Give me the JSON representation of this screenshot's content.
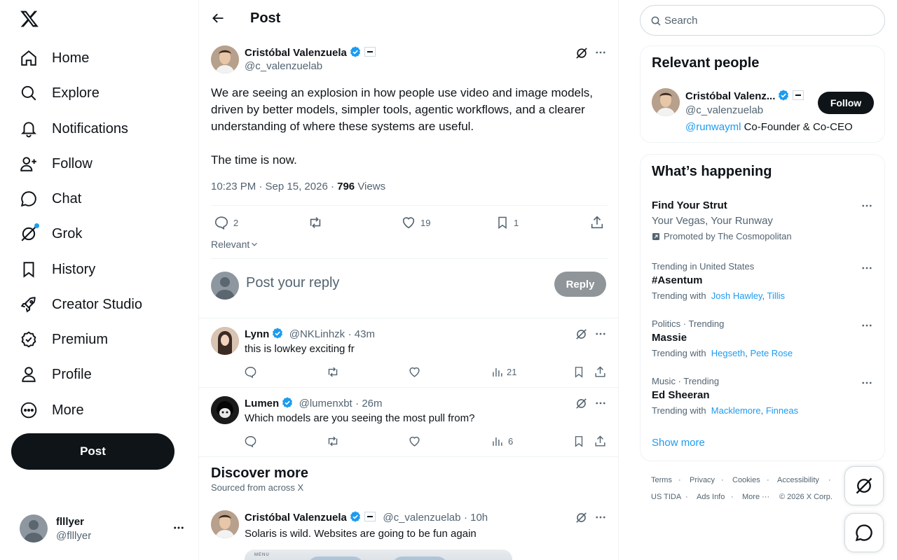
{
  "nav": {
    "items": [
      {
        "label": "Home",
        "icon": "home-icon"
      },
      {
        "label": "Explore",
        "icon": "search-icon"
      },
      {
        "label": "Notifications",
        "icon": "bell-icon"
      },
      {
        "label": "Follow",
        "icon": "person-plus-icon"
      },
      {
        "label": "Chat",
        "icon": "chat-bubble-icon"
      },
      {
        "label": "Grok",
        "icon": "grok-icon"
      },
      {
        "label": "History",
        "icon": "bookmark-icon"
      },
      {
        "label": "Creator Studio",
        "icon": "rocket-icon"
      },
      {
        "label": "Premium",
        "icon": "verified-badge-icon"
      },
      {
        "label": "Profile",
        "icon": "person-icon"
      },
      {
        "label": "More",
        "icon": "more-circle-icon"
      }
    ],
    "post_label": "Post"
  },
  "account": {
    "name": "flllyer",
    "handle": "@flllyer"
  },
  "header": {
    "title": "Post"
  },
  "post": {
    "author_name": "Cristóbal Valenzuela",
    "author_handle": "@c_valenzuelab",
    "text": "We are seeing an explosion in how people use video and image models, driven by better models, simpler tools, agentic workflows, and a clearer understanding of where these systems are useful.\n\nThe time is now.",
    "time": "10:23 PM · Sep 15, 2026 · ",
    "views_count": "796",
    "views_label": " Views",
    "replies": "2",
    "likes": "19",
    "bookmarks": "1"
  },
  "sort_label": "Relevant",
  "reply_box": {
    "placeholder": "Post your reply",
    "button": "Reply"
  },
  "replies": [
    {
      "name": "Lynn",
      "handle": "@NKLinhzk",
      "time": "· 43m",
      "text": "this is lowkey exciting fr",
      "views": "21"
    },
    {
      "name": "Lumen",
      "handle": "@lumenxbt",
      "time": "· 26m",
      "text": "Which models are you seeing the most pull from?",
      "views": "6"
    }
  ],
  "discover": {
    "title": "Discover more",
    "subtitle": "Sourced from across X",
    "post": {
      "name": "Cristóbal Valenzuela",
      "handle": "@c_valenzuelab",
      "time": "· 10h",
      "text": "Solaris is wild. Websites are going to be fun again",
      "media_label": "MENU"
    }
  },
  "search": {
    "placeholder": "Search"
  },
  "relevant_people": {
    "title": "Relevant people",
    "name": "Cristóbal Valenz...",
    "handle": "@c_valenzuelab",
    "bio_link": "@runwayml",
    "bio_rest": " Co-Founder & Co-CEO",
    "follow_label": "Follow"
  },
  "happening": {
    "title": "What’s happening",
    "promo": {
      "title": "Find Your Strut",
      "subtitle": "Your Vegas, Your Runway",
      "promoted": "Promoted by The Cosmopolitan"
    },
    "trends": [
      {
        "context": "Trending in United States",
        "name": "#Asentum",
        "with_label": "Trending with",
        "with_a": "Josh Hawley",
        "with_b": "Tillis"
      },
      {
        "context": "Politics · Trending",
        "name": "Massie",
        "with_label": "Trending with",
        "with_a": "Hegseth",
        "with_b": "Pete Rose"
      },
      {
        "context": "Music · Trending",
        "name": "Ed Sheeran",
        "with_label": "Trending with",
        "with_a": "Macklemore",
        "with_b": "Finneas"
      }
    ],
    "show_more": "Show more"
  },
  "footer": {
    "links": [
      "Terms",
      "Privacy",
      "Cookies",
      "Accessibility",
      "US TIDA",
      "Ads Info",
      "More ···",
      "© 2026 X Corp."
    ]
  },
  "colors": {
    "accent": "#1d9bf0",
    "text": "#0f1419",
    "muted": "#536471",
    "border": "#eff3f4"
  }
}
